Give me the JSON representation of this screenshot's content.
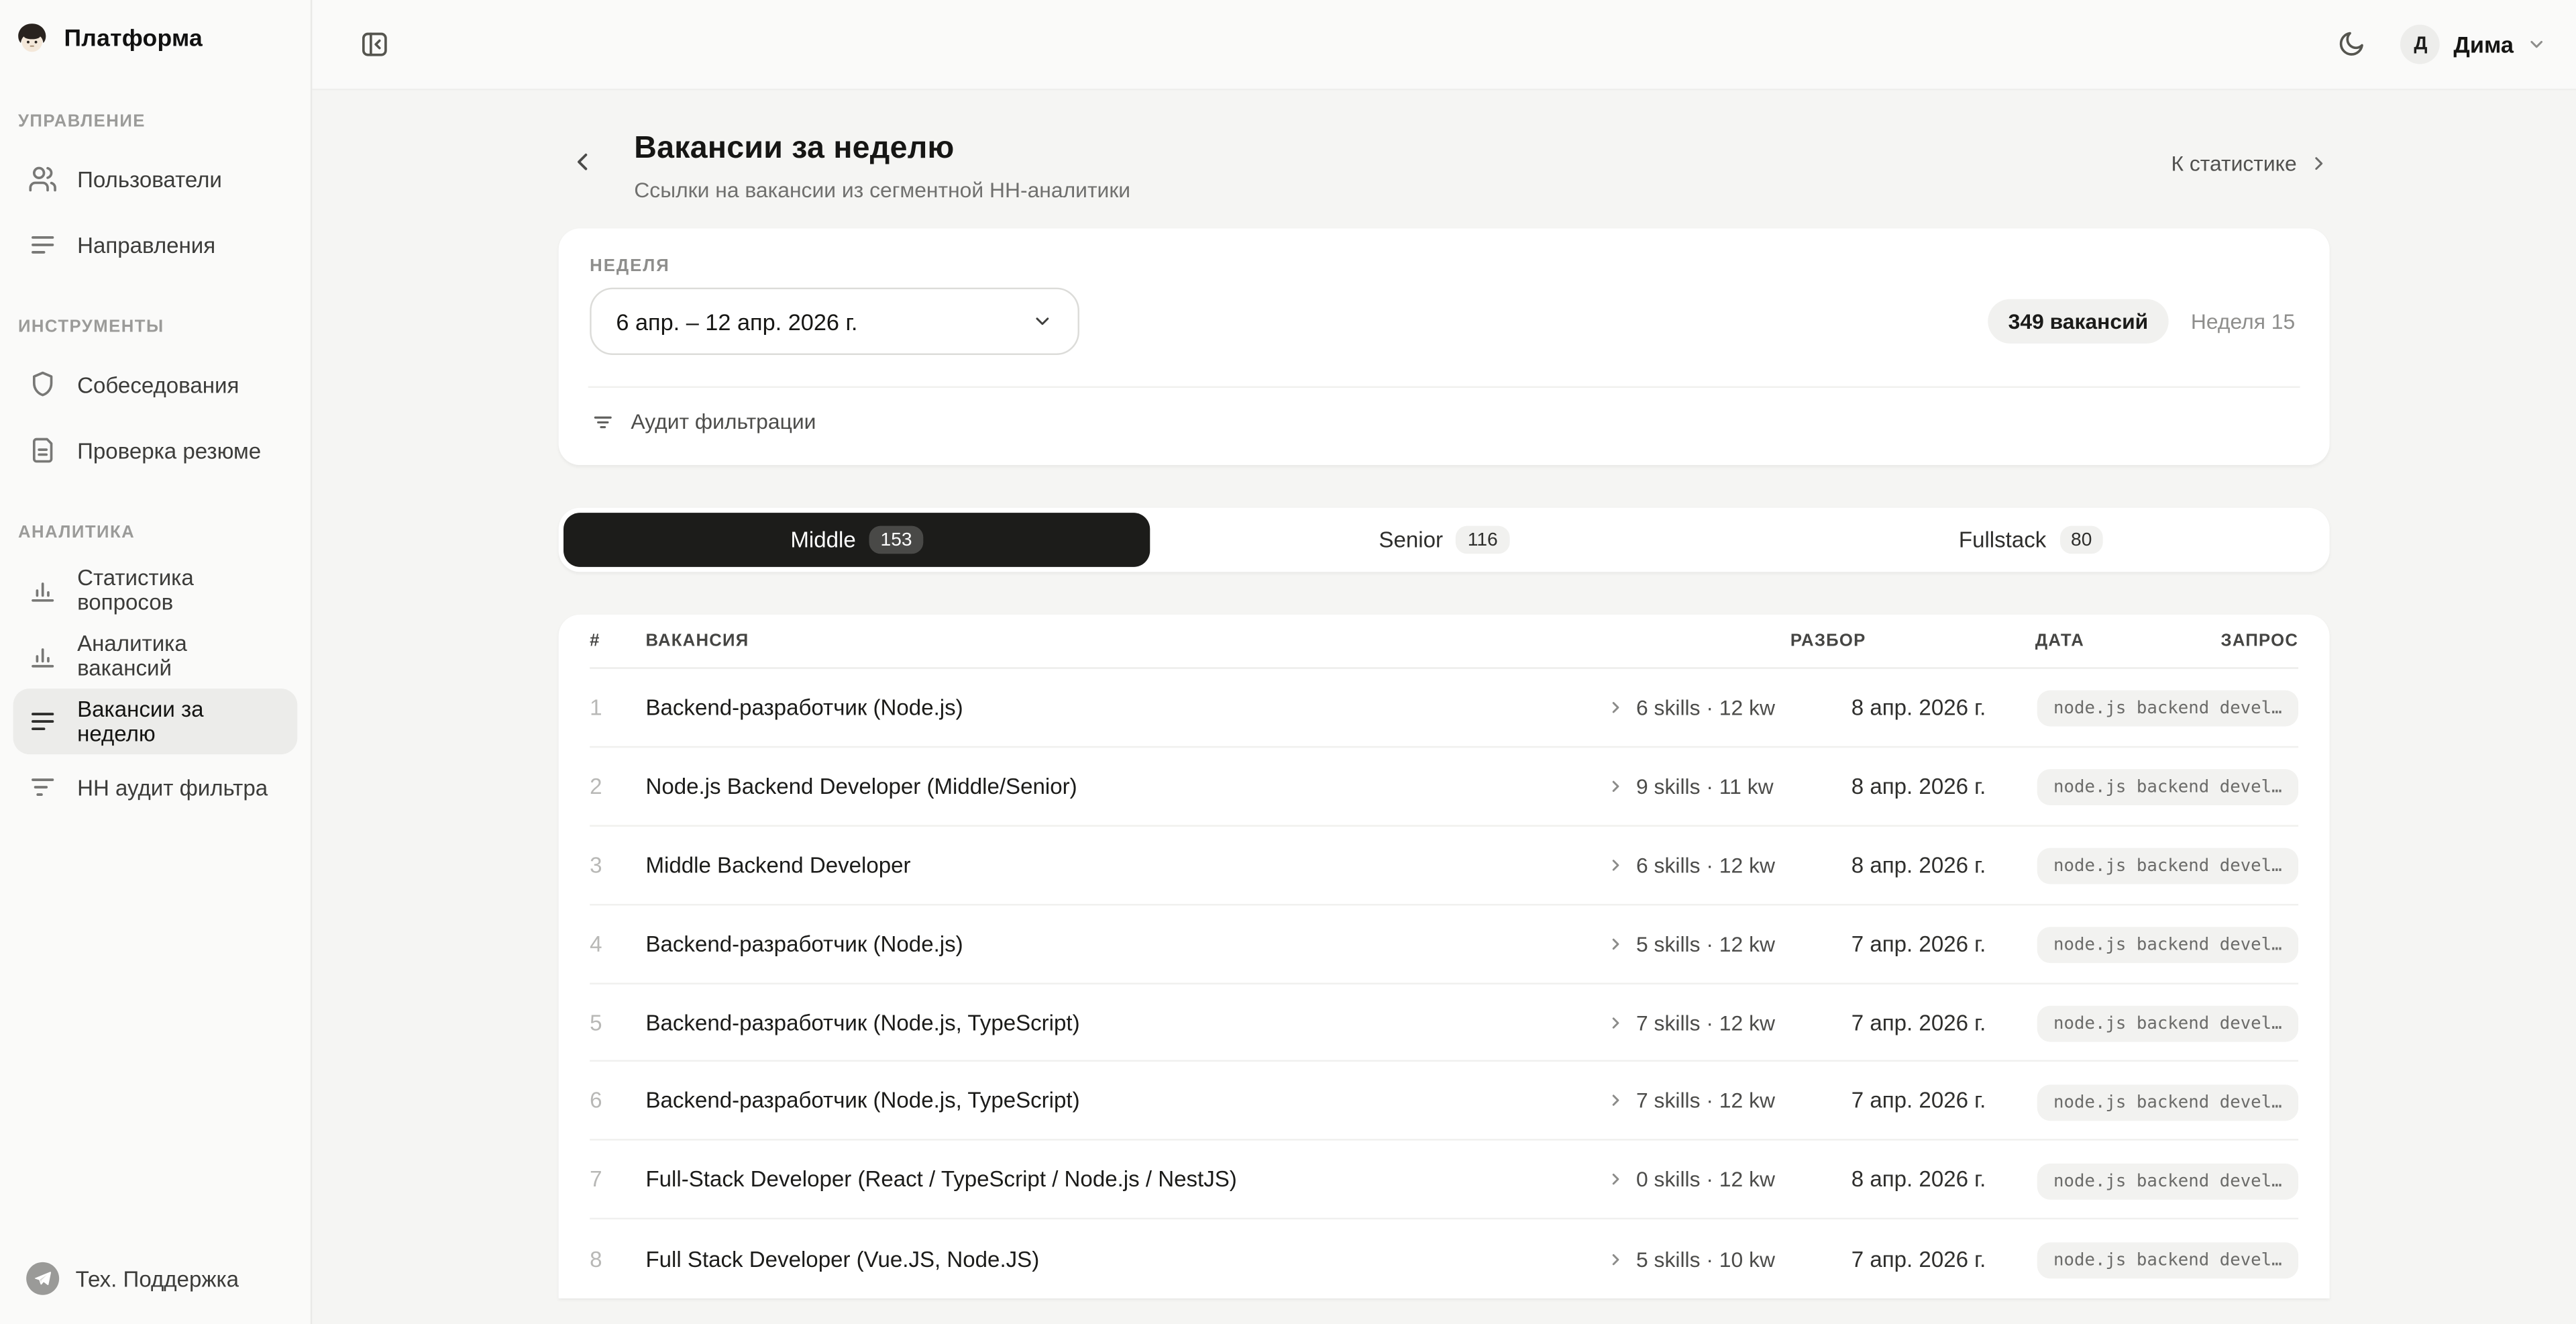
{
  "sidebar": {
    "brand": "Платформа",
    "sections": [
      {
        "title": "УПРАВЛЕНИЕ",
        "items": [
          {
            "label": "Пользователи",
            "icon": "users-icon",
            "active": false
          },
          {
            "label": "Направления",
            "icon": "align-left-icon",
            "active": false
          }
        ]
      },
      {
        "title": "ИНСТРУМЕНТЫ",
        "items": [
          {
            "label": "Собеседования",
            "icon": "shield-icon",
            "active": false
          },
          {
            "label": "Проверка резюме",
            "icon": "document-icon",
            "active": false
          }
        ]
      },
      {
        "title": "АНАЛИТИКА",
        "items": [
          {
            "label": "Статистика вопросов",
            "icon": "bar-chart-icon",
            "active": false
          },
          {
            "label": "Аналитика вакансий",
            "icon": "bar-chart-icon",
            "active": false
          },
          {
            "label": "Вакансии за неделю",
            "icon": "align-left-icon",
            "active": true
          },
          {
            "label": "НН аудит фильтра",
            "icon": "filter-icon",
            "active": false
          }
        ]
      }
    ],
    "support": "Тех. Поддержка"
  },
  "topbar": {
    "user_initial": "Д",
    "user_name": "Дима"
  },
  "header": {
    "title": "Вакансии за неделю",
    "subtitle": "Ссылки на вакансии из сегментной НН-аналитики",
    "stats_link": "К статистике"
  },
  "week_card": {
    "label": "НЕДЕЛЯ",
    "selected_week": "6 апр. – 12 апр. 2026 г.",
    "vacancies_badge": "349 вакансий",
    "week_number": "Неделя 15",
    "audit_toggle": "Аудит фильтрации"
  },
  "tabs": [
    {
      "label": "Middle",
      "count": "153",
      "active": true
    },
    {
      "label": "Senior",
      "count": "116",
      "active": false
    },
    {
      "label": "Fullstack",
      "count": "80",
      "active": false
    }
  ],
  "table": {
    "columns": [
      "#",
      "ВАКАНСИЯ",
      "РАЗБОР",
      "ДАТА",
      "ЗАПРОС"
    ],
    "rows": [
      {
        "num": "1",
        "title": "Backend-разработчик (Node.js)",
        "parse": "6 skills · 12 kw",
        "date": "8 апр. 2026 г.",
        "query": "node.js backend devel…"
      },
      {
        "num": "2",
        "title": "Node.js Backend Developer (Middle/Senior)",
        "parse": "9 skills · 11 kw",
        "date": "8 апр. 2026 г.",
        "query": "node.js backend devel…"
      },
      {
        "num": "3",
        "title": "Middle Backend Developer",
        "parse": "6 skills · 12 kw",
        "date": "8 апр. 2026 г.",
        "query": "node.js backend devel…"
      },
      {
        "num": "4",
        "title": "Backend-разработчик (Node.js)",
        "parse": "5 skills · 12 kw",
        "date": "7 апр. 2026 г.",
        "query": "node.js backend devel…"
      },
      {
        "num": "5",
        "title": "Backend-разработчик (Node.js, TypeScript)",
        "parse": "7 skills · 12 kw",
        "date": "7 апр. 2026 г.",
        "query": "node.js backend devel…"
      },
      {
        "num": "6",
        "title": "Backend-разработчик (Node.js, TypeScript)",
        "parse": "7 skills · 12 kw",
        "date": "7 апр. 2026 г.",
        "query": "node.js backend devel…"
      },
      {
        "num": "7",
        "title": "Full-Stack Developer (React / TypeScript / Node.js / NestJS)",
        "parse": "0 skills · 12 kw",
        "date": "8 апр. 2026 г.",
        "query": "node.js backend devel…"
      },
      {
        "num": "8",
        "title": "Full Stack Developer (Vue.JS, Node.JS)",
        "parse": "5 skills · 10 kw",
        "date": "7 апр. 2026 г.",
        "query": "node.js backend devel…"
      }
    ]
  }
}
